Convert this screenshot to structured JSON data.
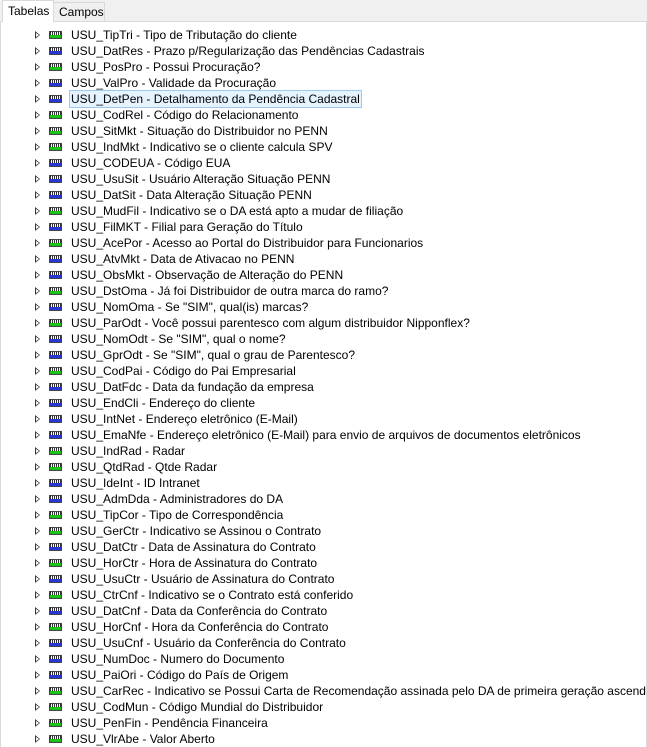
{
  "tabs": [
    {
      "label": "Tabelas",
      "active": true
    },
    {
      "label": "Campos",
      "active": false
    }
  ],
  "colors": {
    "green_icon": "#1cc21c",
    "blue_icon": "#2a34d8",
    "selection": "#e5f3ff"
  },
  "items": [
    {
      "label": "USU_TipTri - Tipo de Tributação do cliente",
      "icon": "green"
    },
    {
      "label": "USU_DatRes - Prazo p/Regularização das Pendências Cadastrais",
      "icon": "blue"
    },
    {
      "label": "USU_PosPro - Possui Procuração?",
      "icon": "green"
    },
    {
      "label": "USU_ValPro - Validade da Procuração",
      "icon": "blue"
    },
    {
      "label": "USU_DetPen - Detalhamento da Pendência Cadastral",
      "icon": "blue",
      "selected": true
    },
    {
      "label": "USU_CodRel - Código do Relacionamento",
      "icon": "green"
    },
    {
      "label": "USU_SitMkt - Situação do Distribuidor no PENN",
      "icon": "green"
    },
    {
      "label": "USU_IndMkt - Indicativo se o cliente calcula SPV",
      "icon": "green"
    },
    {
      "label": "USU_CODEUA - Código EUA",
      "icon": "blue"
    },
    {
      "label": "USU_UsuSit - Usuário Alteração Situação PENN",
      "icon": "blue"
    },
    {
      "label": "USU_DatSit - Data Alteração Situação PENN",
      "icon": "blue"
    },
    {
      "label": "USU_MudFil - Indicativo se o DA está apto a mudar de filiação",
      "icon": "green"
    },
    {
      "label": "USU_FilMKT - Filial para Geração do Título",
      "icon": "blue"
    },
    {
      "label": "USU_AcePor - Acesso ao Portal do Distribuidor para Funcionarios",
      "icon": "green"
    },
    {
      "label": "USU_AtvMkt - Data de Ativacao no PENN",
      "icon": "blue"
    },
    {
      "label": "USU_ObsMkt - Observação de Alteração do PENN",
      "icon": "blue"
    },
    {
      "label": "USU_DstOma - Já foi Distribuidor de outra marca do ramo?",
      "icon": "green"
    },
    {
      "label": "USU_NomOma - Se \"SIM\", qual(is) marcas?",
      "icon": "blue"
    },
    {
      "label": "USU_ParOdt - Você possui parentesco com algum distribuidor Nipponflex?",
      "icon": "green"
    },
    {
      "label": "USU_NomOdt - Se \"SIM\", qual o nome?",
      "icon": "blue"
    },
    {
      "label": "USU_GprOdt - Se \"SIM\", qual o grau de Parentesco?",
      "icon": "blue"
    },
    {
      "label": "USU_CodPai - Código do Pai Empresarial",
      "icon": "green"
    },
    {
      "label": "USU_DatFdc - Data da fundação da empresa",
      "icon": "blue"
    },
    {
      "label": "USU_EndCli - Endereço do cliente",
      "icon": "blue"
    },
    {
      "label": "USU_IntNet - Endereço eletrônico (E-Mail)",
      "icon": "blue"
    },
    {
      "label": "USU_EmaNfe - Endereço eletrônico (E-Mail) para envio de arquivos de documentos eletrônicos",
      "icon": "blue"
    },
    {
      "label": "USU_IndRad - Radar",
      "icon": "green"
    },
    {
      "label": "USU_QtdRad - Qtde Radar",
      "icon": "green"
    },
    {
      "label": "USU_IdeInt - ID Intranet",
      "icon": "blue"
    },
    {
      "label": "USU_AdmDda - Administradores do DA",
      "icon": "blue"
    },
    {
      "label": "USU_TipCor - Tipo de Correspondência",
      "icon": "green"
    },
    {
      "label": "USU_GerCtr - Indicativo se Assinou o Contrato",
      "icon": "green"
    },
    {
      "label": "USU_DatCtr - Data de Assinatura do Contrato",
      "icon": "blue"
    },
    {
      "label": "USU_HorCtr - Hora de Assinatura do Contrato",
      "icon": "green"
    },
    {
      "label": "USU_UsuCtr - Usuário de Assinatura do Contrato",
      "icon": "blue"
    },
    {
      "label": "USU_CtrCnf - Indicativo se o Contrato está conferido",
      "icon": "green"
    },
    {
      "label": "USU_DatCnf - Data da Conferência do Contrato",
      "icon": "blue"
    },
    {
      "label": "USU_HorCnf - Hora da Conferência do Contrato",
      "icon": "green"
    },
    {
      "label": "USU_UsuCnf - Usuário da Conferência do Contrato",
      "icon": "blue"
    },
    {
      "label": "USU_NumDoc - Numero do Documento",
      "icon": "blue"
    },
    {
      "label": "USU_PaiOri - Código do País de Origem",
      "icon": "blue"
    },
    {
      "label": "USU_CarRec - Indicativo se Possui Carta de Recomendação assinada pelo DA de primeira geração ascendente",
      "icon": "green"
    },
    {
      "label": "USU_CodMun - Código Mundial do Distribuidor",
      "icon": "green"
    },
    {
      "label": "USU_PenFin - Pendência Financeira",
      "icon": "green"
    },
    {
      "label": "USU_VlrAbe - Valor Aberto",
      "icon": "green"
    }
  ]
}
